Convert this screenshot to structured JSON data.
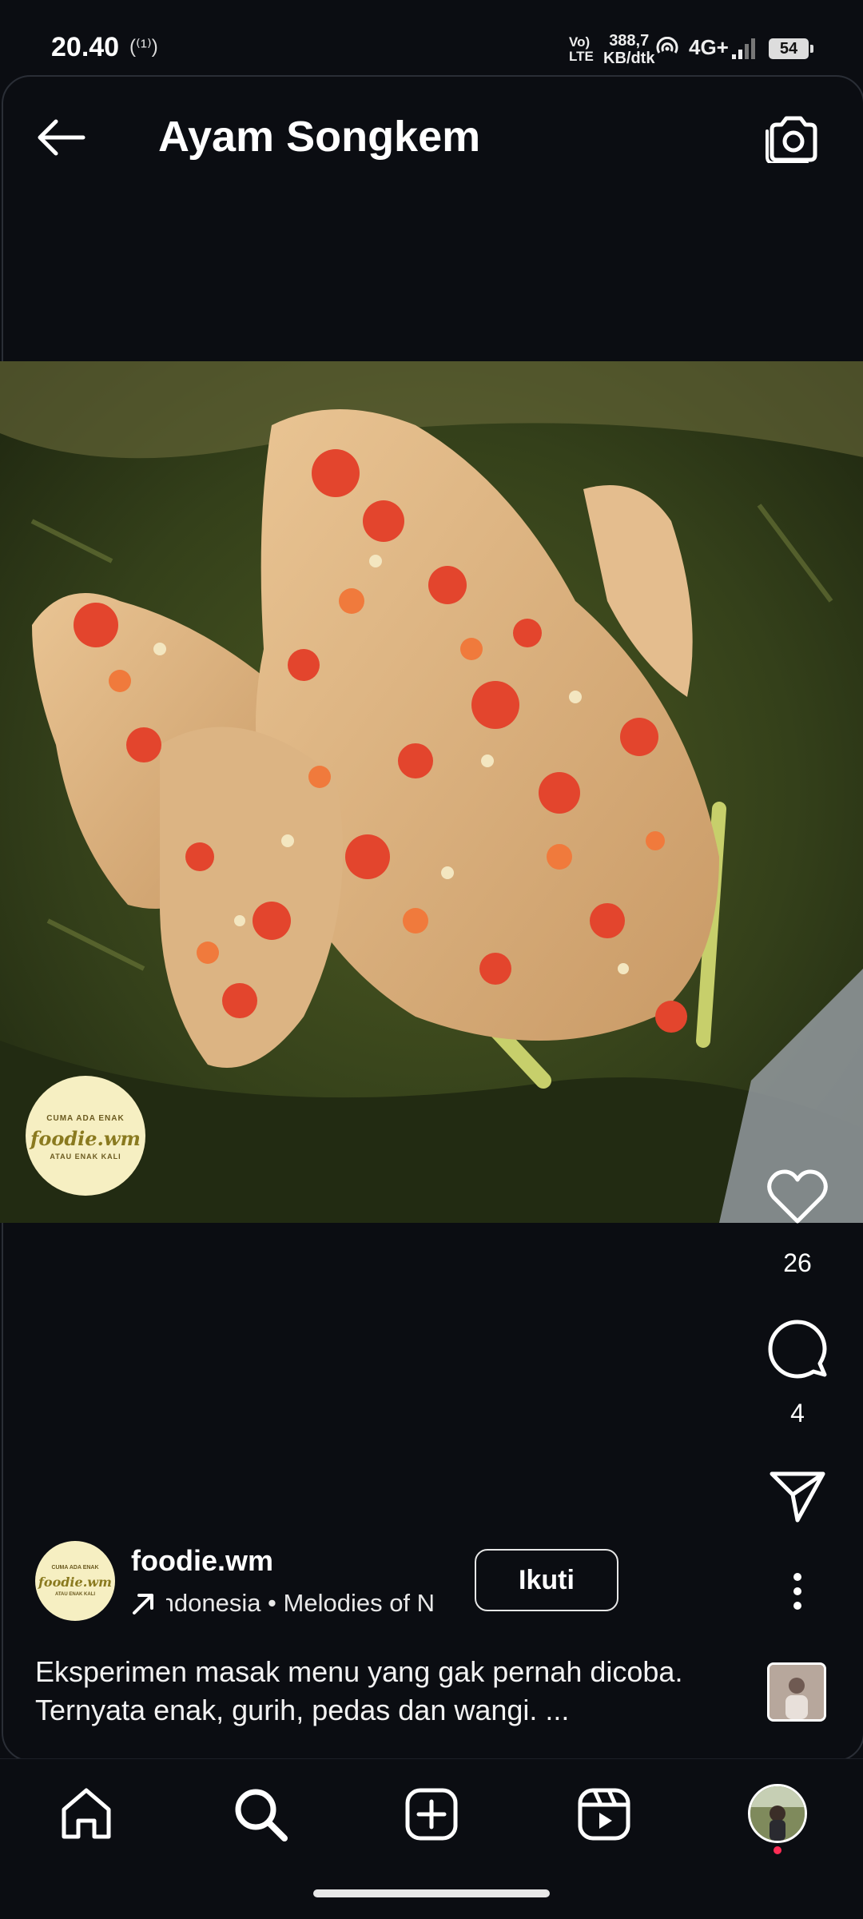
{
  "status_bar": {
    "time": "20.40",
    "radio_indicator": "(⁽¹⁾)",
    "volte": [
      "Vo)",
      "LTE"
    ],
    "speed_value": "388,7",
    "speed_unit": "KB/dtk",
    "network": "4G+",
    "battery": "54"
  },
  "header": {
    "title": "Ayam Songkem",
    "back_icon": "back-arrow-icon",
    "camera_icon": "camera-icon"
  },
  "post": {
    "image_subject": "food-photo",
    "watermark": {
      "top_text": "CUMA ADA ENAK",
      "brand": "foodie.wm",
      "bottom_text": "ATAU ENAK KALI"
    }
  },
  "actions": {
    "likes": "26",
    "comments": "4"
  },
  "author": {
    "username": "foodie.wm",
    "avatar_top": "CUMA ADA ENAK",
    "avatar_brand": "foodie.wm",
    "avatar_bottom": "ATAU ENAK KALI",
    "audio_text": "Indonesia • Melodies of N",
    "follow_label": "Ikuti"
  },
  "caption": {
    "line1": "Eksperimen masak menu yang gak pernah dicoba.",
    "line2": "Ternyata enak, gurih, pedas dan wangi. ..."
  },
  "bottom_nav": {
    "items": [
      "home-icon",
      "search-icon",
      "create-icon",
      "reels-icon",
      "profile-avatar"
    ]
  },
  "colors": {
    "background": "#0b0d12",
    "text": "#ffffff",
    "notification_dot": "#ff2d55"
  }
}
